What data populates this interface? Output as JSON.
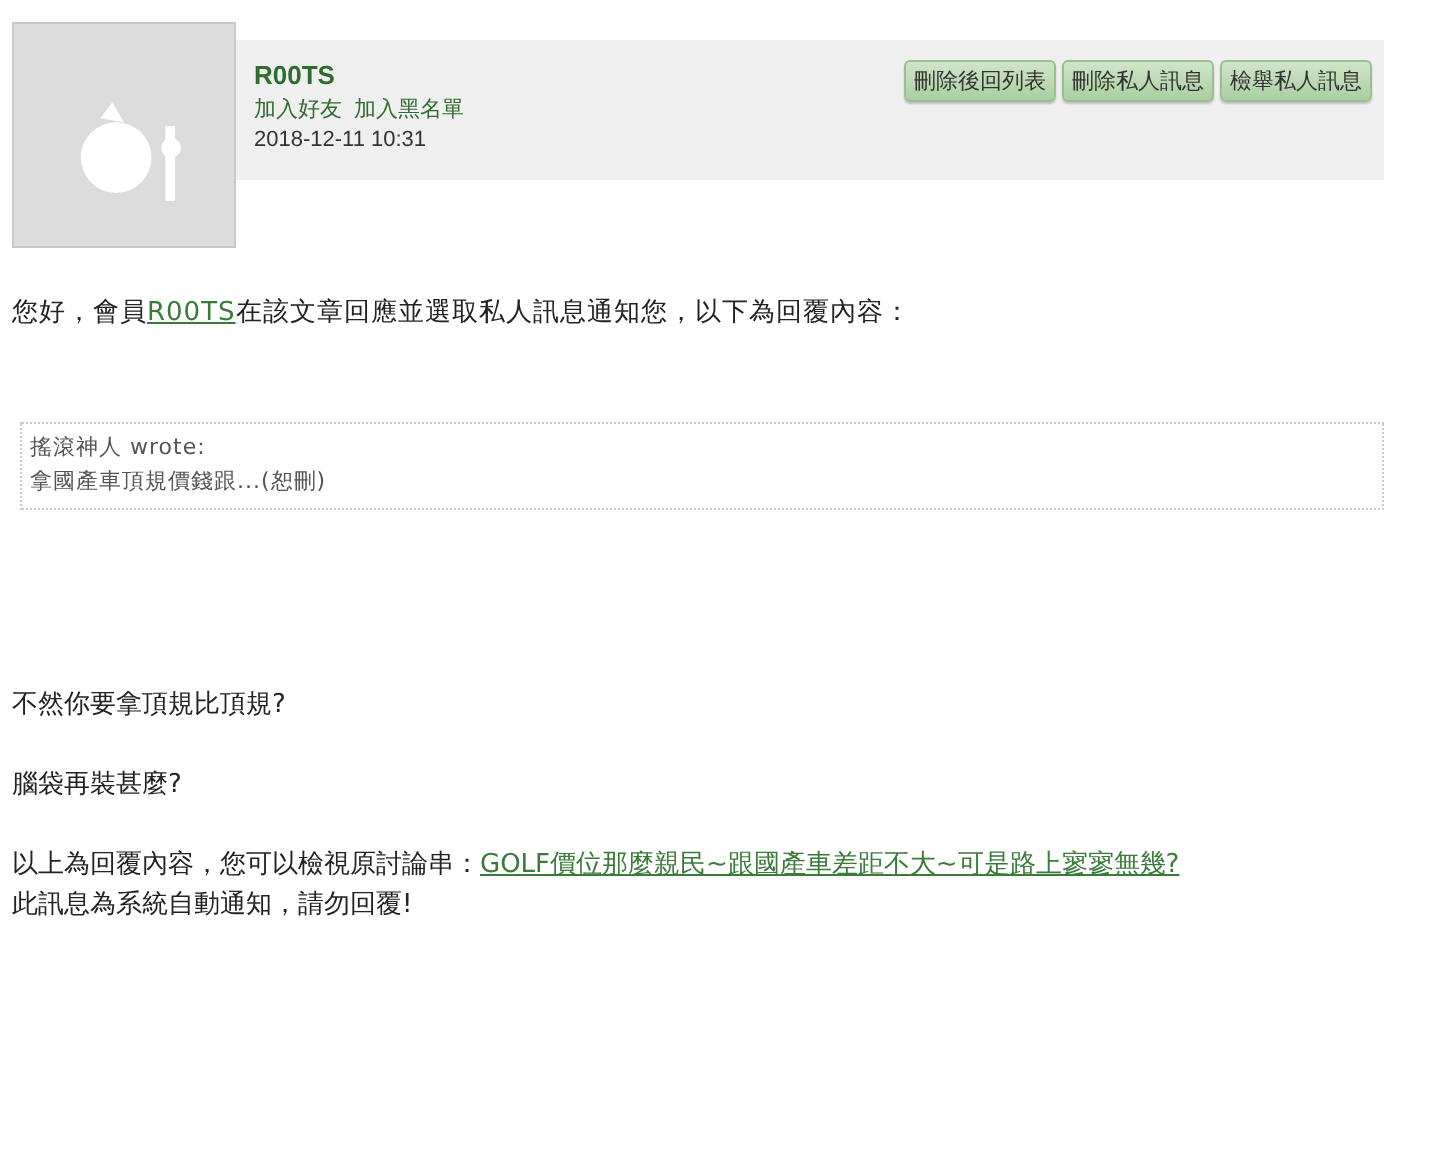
{
  "header": {
    "username": "R00TS",
    "actions": [
      "加入好友",
      "加入黑名單"
    ],
    "timestamp": "2018-12-11 10:31",
    "buttons": [
      "刪除後回列表",
      "刪除私人訊息",
      "檢舉私人訊息"
    ]
  },
  "intro": {
    "before": "您好，會員",
    "link": "R00TS",
    "after": "在該文章回應並選取私人訊息通知您，以下為回覆內容："
  },
  "quote": {
    "author": "搖滾神人 wrote:",
    "text": "拿國產車頂規價錢跟...(恕刪)"
  },
  "paragraphs": [
    "不然你要拿頂規比頂規?",
    "腦袋再裝甚麼?"
  ],
  "footer": {
    "before": "以上為回覆內容，您可以檢視原討論串：",
    "link": "GOLF價位那麼親民~跟國產車差距不大~可是路上寥寥無幾?",
    "notice": "此訊息為系統自動通知，請勿回覆!"
  }
}
